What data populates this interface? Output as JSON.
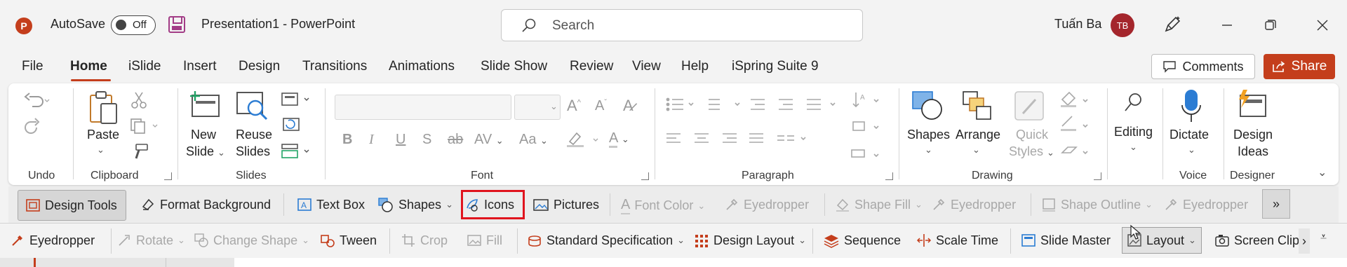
{
  "titlebar": {
    "logo": "P",
    "autosave_label": "AutoSave",
    "toggle_state": "Off",
    "doc_title": "Presentation1  -  PowerPoint",
    "search_placeholder": "Search",
    "user_name": "Tuấn Ba",
    "user_initials": "TB",
    "icons": [
      "powerpoint-logo-icon",
      "save-icon",
      "search-icon",
      "designer-pen-icon",
      "minimize-icon",
      "restore-icon",
      "close-icon"
    ]
  },
  "tabs": [
    "File",
    "Home",
    "iSlide",
    "Insert",
    "Design",
    "Transitions",
    "Animations",
    "Slide Show",
    "Review",
    "View",
    "Help",
    "iSpring Suite 9"
  ],
  "active_tab": "Home",
  "actions": {
    "comments": "Comments",
    "share": "Share"
  },
  "ribbon": {
    "groups": {
      "undo": "Undo",
      "clipboard": "Clipboard",
      "slides": "Slides",
      "font": "Font",
      "paragraph": "Paragraph",
      "drawing": "Drawing",
      "voice": "Voice",
      "designer": "Designer"
    },
    "buttons": {
      "paste": "Paste",
      "new_slide_1": "New",
      "new_slide_2": "Slide",
      "reuse_1": "Reuse",
      "reuse_2": "Slides",
      "shapes": "Shapes",
      "arrange": "Arrange",
      "quick_1": "Quick",
      "quick_2": "Styles",
      "editing": "Editing",
      "dictate": "Dictate",
      "design_1": "Design",
      "design_2": "Ideas"
    },
    "font_buttons": [
      "B",
      "I",
      "U",
      "S",
      "ab",
      "AV",
      "Aa"
    ]
  },
  "toolbar1": {
    "design_tools": "Design Tools",
    "format_background": "Format Background",
    "text_box": "Text Box",
    "shapes": "Shapes",
    "icons": "Icons",
    "pictures": "Pictures",
    "font_color": "Font Color",
    "eyedropper1": "Eyedropper",
    "shape_fill": "Shape Fill",
    "eyedropper2": "Eyedropper",
    "shape_outline": "Shape Outline",
    "eyedropper3": "Eyedropper",
    "more": "»"
  },
  "toolbar2": {
    "eyedropper": "Eyedropper",
    "rotate": "Rotate",
    "change_shape": "Change Shape",
    "tween": "Tween",
    "crop": "Crop",
    "fill": "Fill",
    "standard_spec": "Standard Specification",
    "design_layout": "Design Layout",
    "sequence": "Sequence",
    "scale_time": "Scale Time",
    "slide_master": "Slide Master",
    "layout": "Layout",
    "screen_clip": "Screen Clip",
    "overflow": "›"
  },
  "colors": {
    "accent": "#c43e1c",
    "highlight": "#e0141e",
    "avatar": "#a4262c"
  }
}
